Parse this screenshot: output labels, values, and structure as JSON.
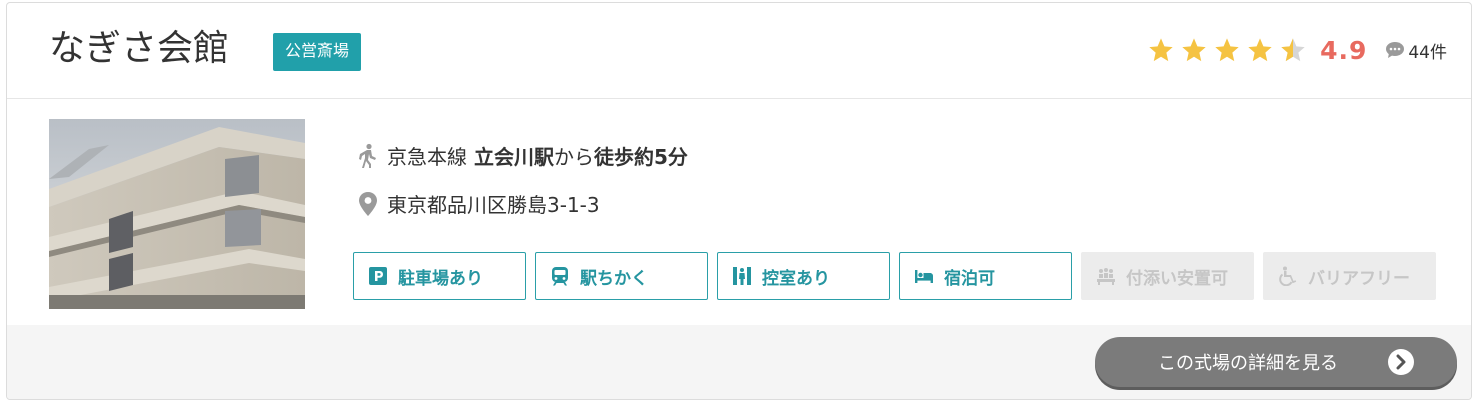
{
  "hall": {
    "name": "なぎさ会館",
    "type_badge": "公営斎場"
  },
  "rating": {
    "stars": 4.5,
    "value": "4.9",
    "review_count": "44件",
    "star_color": "#f5c342",
    "star_empty_color": "#d6d6d6",
    "value_color": "#e86a5f"
  },
  "access": {
    "line": "京急本線",
    "station": "立会川駅",
    "from": "から",
    "walk": "徒歩約5分",
    "icon": "walking-person-icon"
  },
  "address": {
    "text": "東京都品川区勝島3-1-3",
    "icon": "map-pin-icon"
  },
  "tags": [
    {
      "label": "駐車場あり",
      "icon": "parking-icon",
      "active": true
    },
    {
      "label": "駅ちかく",
      "icon": "train-icon",
      "active": true
    },
    {
      "label": "控室あり",
      "icon": "waiting-room-icon",
      "active": true
    },
    {
      "label": "宿泊可",
      "icon": "bed-icon",
      "active": true
    },
    {
      "label": "付添い安置可",
      "icon": "attendance-icon",
      "active": false
    },
    {
      "label": "バリアフリー",
      "icon": "wheelchair-icon",
      "active": false
    }
  ],
  "detail_button": {
    "label": "この式場の詳細を見る",
    "icon": "chevron-right-circle-icon"
  },
  "colors": {
    "accent": "#21a0aa",
    "button_bg": "#7b7b7b"
  }
}
